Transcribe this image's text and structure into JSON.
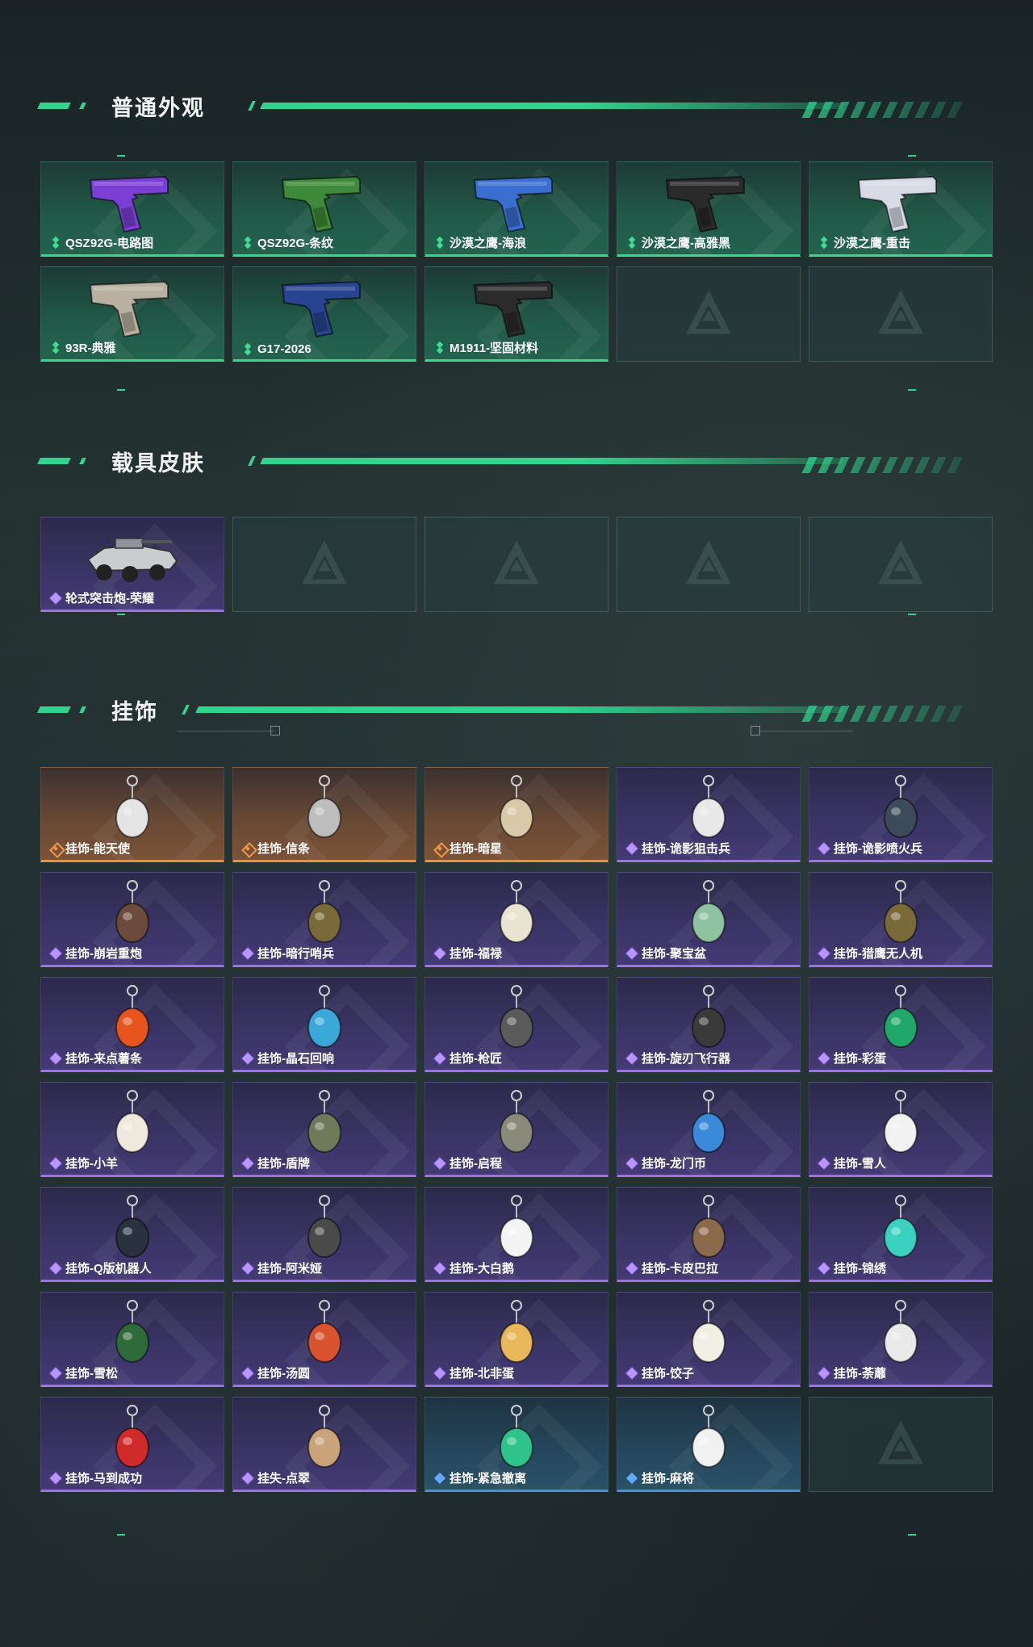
{
  "sections": {
    "weapons": {
      "title": "普通外观",
      "items": [
        {
          "label": "QSZ92G-电路图",
          "rarity": "green",
          "color": "#7b3fd6",
          "icon": "pistol-icon"
        },
        {
          "label": "QSZ92G-条纹",
          "rarity": "green",
          "color": "#3f8a3a",
          "icon": "pistol-icon"
        },
        {
          "label": "沙漠之鹰-海浪",
          "rarity": "green",
          "color": "#3a6fd1",
          "icon": "pistol-icon"
        },
        {
          "label": "沙漠之鹰-高雅黑",
          "rarity": "green",
          "color": "#2a2a2a",
          "icon": "pistol-icon"
        },
        {
          "label": "沙漠之鹰-重击",
          "rarity": "green",
          "color": "#d8dbe6",
          "icon": "pistol-icon"
        },
        {
          "label": "93R-典雅",
          "rarity": "green",
          "color": "#b9b0a2",
          "icon": "pistol-icon"
        },
        {
          "label": "G17-2026",
          "rarity": "green",
          "color": "#28438f",
          "icon": "pistol-icon"
        },
        {
          "label": "M1911-坚固材料",
          "rarity": "green",
          "color": "#2b2b2b",
          "icon": "pistol-icon"
        }
      ],
      "empty_slots": 2
    },
    "vehicles": {
      "title": "载具皮肤",
      "items": [
        {
          "label": "轮式突击炮-荣耀",
          "rarity": "purple",
          "color": "#c9cdd0",
          "icon": "vehicle-icon"
        }
      ],
      "empty_slots": 4
    },
    "charms": {
      "title": "挂饰",
      "items": [
        {
          "label": "挂饰-能天使",
          "rarity": "orange",
          "color": "#e4e4e4",
          "icon": "charm-icon"
        },
        {
          "label": "挂饰-信条",
          "rarity": "orange",
          "color": "#bdbdbd",
          "icon": "charm-icon"
        },
        {
          "label": "挂饰-暗星",
          "rarity": "orange",
          "color": "#d9c9a8",
          "icon": "charm-icon"
        },
        {
          "label": "挂饰-诡影狙击兵",
          "rarity": "purple",
          "color": "#e8e8e8",
          "icon": "charm-icon"
        },
        {
          "label": "挂饰-诡影喷火兵",
          "rarity": "purple",
          "color": "#3d4a5a",
          "icon": "charm-icon"
        },
        {
          "label": "挂饰-崩岩重炮",
          "rarity": "purple",
          "color": "#6b4b3b",
          "icon": "charm-icon"
        },
        {
          "label": "挂饰-暗行哨兵",
          "rarity": "purple",
          "color": "#7a6a3a",
          "icon": "charm-icon"
        },
        {
          "label": "挂饰-福禄",
          "rarity": "purple",
          "color": "#e9e3d2",
          "icon": "charm-icon"
        },
        {
          "label": "挂饰-聚宝盆",
          "rarity": "purple",
          "color": "#8fc2a0",
          "icon": "charm-icon"
        },
        {
          "label": "挂饰-猎鹰无人机",
          "rarity": "purple",
          "color": "#7a6a3a",
          "icon": "charm-icon"
        },
        {
          "label": "挂饰-来点薯条",
          "rarity": "purple",
          "color": "#e8541e",
          "icon": "charm-icon"
        },
        {
          "label": "挂饰-晶石回响",
          "rarity": "purple",
          "color": "#3aa9d9",
          "icon": "charm-icon"
        },
        {
          "label": "挂饰-枪匠",
          "rarity": "purple",
          "color": "#5a5a5a",
          "icon": "charm-icon"
        },
        {
          "label": "挂饰-旋刃飞行器",
          "rarity": "purple",
          "color": "#3a3a3a",
          "icon": "charm-icon"
        },
        {
          "label": "挂饰-彩蛋",
          "rarity": "purple",
          "color": "#1fa86a",
          "icon": "charm-icon"
        },
        {
          "label": "挂饰-小羊",
          "rarity": "purple",
          "color": "#efe8dc",
          "icon": "charm-icon"
        },
        {
          "label": "挂饰-盾牌",
          "rarity": "purple",
          "color": "#6e7a5a",
          "icon": "charm-icon"
        },
        {
          "label": "挂饰-启程",
          "rarity": "purple",
          "color": "#8a8a7a",
          "icon": "charm-icon"
        },
        {
          "label": "挂饰-龙门币",
          "rarity": "purple",
          "color": "#3a8ad9",
          "icon": "charm-icon"
        },
        {
          "label": "挂饰-雪人",
          "rarity": "purple",
          "color": "#f2f2f2",
          "icon": "charm-icon"
        },
        {
          "label": "挂饰-Q版机器人",
          "rarity": "purple",
          "color": "#2a3240",
          "icon": "charm-icon"
        },
        {
          "label": "挂饰-阿米娅",
          "rarity": "purple",
          "color": "#4a4a4a",
          "icon": "charm-icon"
        },
        {
          "label": "挂饰-大白鹅",
          "rarity": "purple",
          "color": "#f4f4f4",
          "icon": "charm-icon"
        },
        {
          "label": "挂饰-卡皮巴拉",
          "rarity": "purple",
          "color": "#8a6a4a",
          "icon": "charm-icon"
        },
        {
          "label": "挂饰-锦绣",
          "rarity": "purple",
          "color": "#3ad1c1",
          "icon": "charm-icon"
        },
        {
          "label": "挂饰-雪松",
          "rarity": "purple",
          "color": "#2e6a3a",
          "icon": "charm-icon"
        },
        {
          "label": "挂饰-汤圆",
          "rarity": "purple",
          "color": "#d9532e",
          "icon": "charm-icon"
        },
        {
          "label": "挂饰-北非蛋",
          "rarity": "purple",
          "color": "#e9b85a",
          "icon": "charm-icon"
        },
        {
          "label": "挂饰-饺子",
          "rarity": "purple",
          "color": "#f1eee4",
          "icon": "charm-icon"
        },
        {
          "label": "挂饰-荼蘼",
          "rarity": "purple",
          "color": "#e9e9e9",
          "icon": "charm-icon"
        },
        {
          "label": "挂饰-马到成功",
          "rarity": "purple",
          "color": "#d12a2a",
          "icon": "charm-icon"
        },
        {
          "label": "挂失-点翠",
          "rarity": "purple",
          "color": "#c9a37a",
          "icon": "charm-icon"
        },
        {
          "label": "挂饰-紧急撤离",
          "rarity": "blue",
          "color": "#2fc28a",
          "icon": "charm-icon"
        },
        {
          "label": "挂饰-麻将",
          "rarity": "blue",
          "color": "#f1f1f1",
          "icon": "charm-icon"
        }
      ],
      "empty_slots": 1
    }
  },
  "accent": "#2fd58f"
}
